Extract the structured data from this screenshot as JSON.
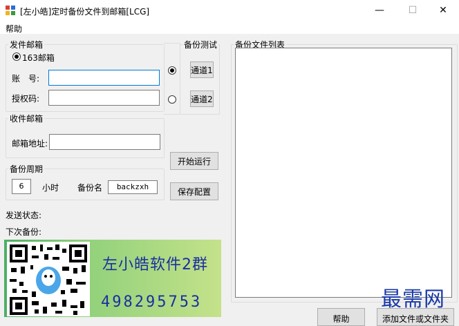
{
  "window": {
    "title": "[左小皓]定时备份文件到邮箱[LCG]",
    "minimize": "—",
    "maximize": "☐",
    "close": "✕"
  },
  "menu": {
    "help": "帮助"
  },
  "sender": {
    "legend": "发件邮箱",
    "provider_option": "163邮箱",
    "account_label": "账　号:",
    "account_value": "",
    "auth_label": "授权码:",
    "auth_value": ""
  },
  "test": {
    "legend": "备份测试",
    "channel1": "通道1",
    "channel2": "通道2"
  },
  "receiver": {
    "legend": "收件邮箱",
    "address_label": "邮箱地址:",
    "address_value": ""
  },
  "period": {
    "legend": "备份周期",
    "hours_value": "6",
    "hours_unit": "小时",
    "backup_name_label": "备份名",
    "backup_name_value": "backzxh"
  },
  "actions": {
    "start": "开始运行",
    "save": "保存配置"
  },
  "status": {
    "send_status_label": "发送状态:",
    "next_backup_label": "下次备份:"
  },
  "file_list": {
    "legend": "备份文件列表"
  },
  "bottom_buttons": {
    "help_partial": "帮助",
    "add_partial": "添加文件或文件夹"
  },
  "banner": {
    "line1": "左小皓软件2群",
    "line2": "498295753"
  },
  "watermark": "最需网",
  "colors": {
    "banner_text": "#1b2fa0",
    "focus_border": "#0078d7"
  }
}
